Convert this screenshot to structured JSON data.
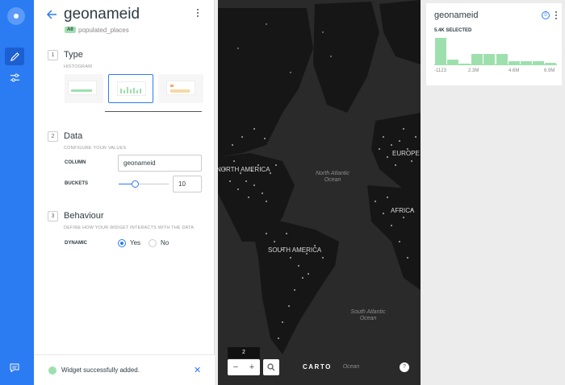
{
  "editor": {
    "title": "geonameid",
    "source_badge": "A0",
    "source_name": "populated_places",
    "sections": [
      {
        "number": "1",
        "title": "Type",
        "subtitle": "HISTOGRAM"
      },
      {
        "number": "2",
        "title": "Data",
        "subtitle": "CONFIGURE YOUR VALUES"
      },
      {
        "number": "3",
        "title": "Behaviour",
        "subtitle": "DEFINE HOW YOUR WIDGET INTERACTS WITH THE DATA"
      }
    ],
    "column_label": "COLUMN",
    "column_value": "geonameid",
    "buckets_label": "BUCKETS",
    "buckets_value": "10",
    "buckets_slider_fraction": 0.34,
    "dynamic_label": "DYNAMIC",
    "dynamic_yes": "Yes",
    "dynamic_no": "No",
    "dynamic_selected": "Yes"
  },
  "notification": {
    "text": "Widget successfully added."
  },
  "map": {
    "labels": {
      "north_america": "NORTH AMERICA",
      "south_america": "SOUTH AMERICA",
      "europe": "EUROPE",
      "africa": "AFRICA",
      "north_atlantic_1": "North Atlantic",
      "north_atlantic_2": "Ocean",
      "south_atlantic_1": "South Atlantic",
      "south_atlantic_2": "Ocean",
      "bottom_ocean": "Ocean"
    },
    "zoom_level": "2",
    "zoom_out": "−",
    "zoom_in": "+",
    "attribution": "CARTO",
    "help": "?"
  },
  "widget": {
    "title": "geonameid",
    "selected": "5.4K SELECTED",
    "info": "0",
    "axis_labels": [
      "-1123",
      "2.3M",
      "4.6M",
      "6.9M"
    ],
    "bar_fractions": [
      1.0,
      0.2,
      0.06,
      0.4,
      0.42,
      0.42,
      0.14,
      0.16,
      0.16,
      0.1
    ],
    "bar_color": "#9de0ad"
  },
  "colors": {
    "accent": "#2b7bf3",
    "rail": "#2b7bf3",
    "map_bg": "#2a2a2a",
    "success": "#9de0ad"
  }
}
